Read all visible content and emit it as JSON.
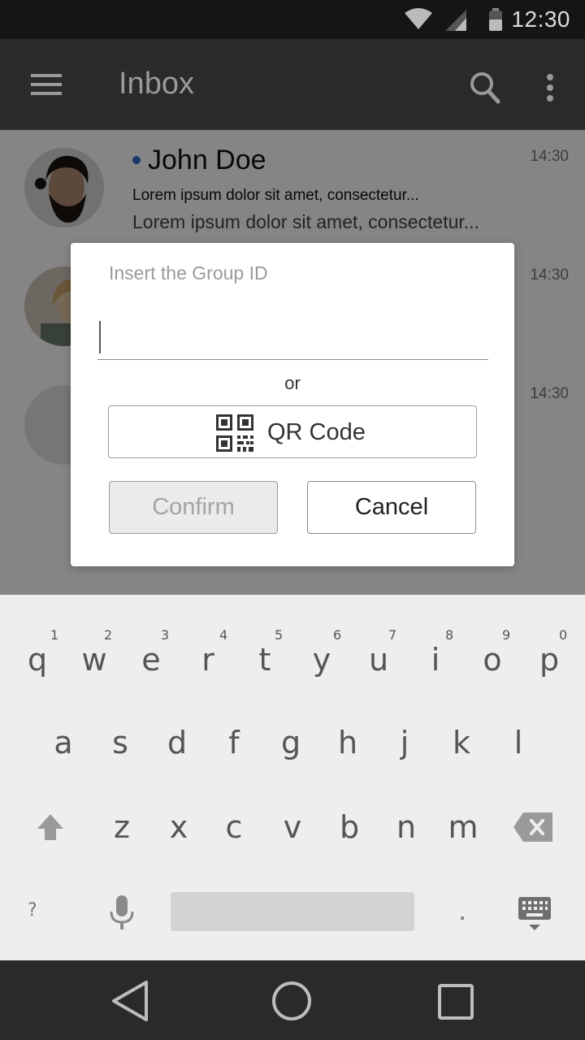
{
  "status_bar": {
    "time": "12:30"
  },
  "app_bar": {
    "title": "Inbox"
  },
  "messages": [
    {
      "sender": "John Doe",
      "preview_line1": "Lorem ipsum dolor sit amet, consectetur...",
      "preview_line2": "Lorem ipsum dolor sit amet, consectetur...",
      "time": "14:30"
    },
    {
      "time": "14:30"
    },
    {
      "time": "14:30"
    }
  ],
  "dialog": {
    "hint": "Insert the Group ID",
    "input_value": "",
    "or_label": "or",
    "qr_button_label": "QR Code",
    "confirm_label": "Confirm",
    "cancel_label": "Cancel"
  },
  "keyboard": {
    "row1": [
      "q",
      "w",
      "e",
      "r",
      "t",
      "y",
      "u",
      "i",
      "o",
      "p"
    ],
    "row1_numbers": [
      "1",
      "2",
      "3",
      "4",
      "5",
      "6",
      "7",
      "8",
      "9",
      "0"
    ],
    "row2": [
      "a",
      "s",
      "d",
      "f",
      "g",
      "h",
      "j",
      "k",
      "l"
    ],
    "row3": [
      "z",
      "x",
      "c",
      "v",
      "b",
      "n",
      "m"
    ],
    "symbols_key": "?",
    "period_key": "."
  },
  "colors": {
    "unread_dot": "#2f6cc7",
    "app_bar": "#2a2a2a",
    "status_bar": "#151515"
  }
}
